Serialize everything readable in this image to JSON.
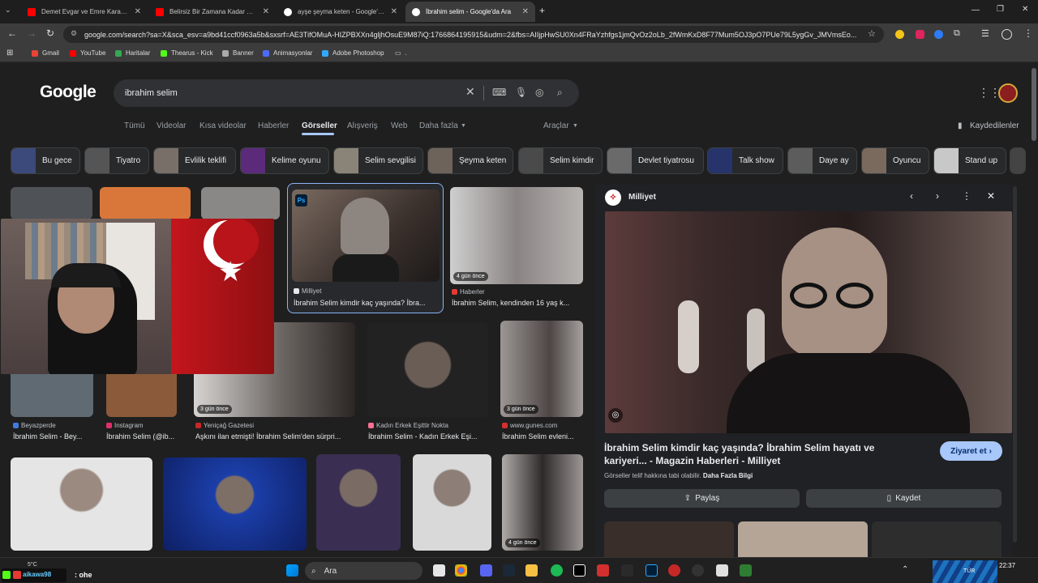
{
  "browser": {
    "tabs": [
      {
        "title": "Demet Evgar ve Emre Karayel'in",
        "favicon": "youtube-icon",
        "color": "#ff0000"
      },
      {
        "title": "Belirsiz Bir Zamana Kadar Güle",
        "favicon": "youtube-icon",
        "color": "#ff0000"
      },
      {
        "title": "ayşe şeyma keten - Google'da A",
        "favicon": "google-icon",
        "color": "#ffffff"
      },
      {
        "title": "İbrahim selim - Google'da Ara",
        "favicon": "google-icon",
        "color": "#ffffff"
      }
    ],
    "new_tab": "+",
    "url": "google.com/search?sa=X&sca_esv=a9bd41ccf0963a5b&sxsrf=AE3TifOMuA-HIZPBXXn4gljhOsuE9M87iQ:1766864195915&udm=2&fbs=AIIjpHwSU0Xn4FRaYzhfgs1jmQvOz2oLb_2fWmKxD8F77Mum5OJ3pO7PUe79L5ygGv_JMVmsEo...",
    "bookmarks": [
      {
        "label": "Gmail",
        "color": "#ea4335"
      },
      {
        "label": "YouTube",
        "color": "#ff0000"
      },
      {
        "label": "Haritalar",
        "color": "#34a853"
      },
      {
        "label": "Thearus - Kick",
        "color": "#53fc18"
      },
      {
        "label": "Banner",
        "color": "#aaaaaa"
      },
      {
        "label": "Animasyonlar",
        "color": "#4d6bfe"
      },
      {
        "label": "Adobe Photoshop",
        "color": "#31a8ff"
      },
      {
        "label": ".",
        "color": "#e8e8e8"
      }
    ]
  },
  "google": {
    "logo": "Google",
    "query": "ibrahim selim",
    "nav": [
      "Tümü",
      "Videolar",
      "Kısa videolar",
      "Haberler",
      "Görseller",
      "Alışveriş",
      "Web",
      "Daha fazla"
    ],
    "selected_nav": "Görseller",
    "tools": "Araçlar",
    "saved": "Kaydedilenler",
    "chips": [
      "Bu gece",
      "Tiyatro",
      "Evlilik teklifi",
      "Kelime oyunu",
      "Selim sevgilisi",
      "Şeyma keten",
      "Selim kimdir",
      "Devlet tiyatrosu",
      "Talk show",
      "Daye ay",
      "Oyuncu",
      "Stand up"
    ]
  },
  "results": {
    "row1": [
      {
        "source": "Milliyet",
        "title": "İbrahim Selim kimdir kaç yaşında? İbra...",
        "src_color": "#e8e8e8",
        "img_color": "#6a5a52"
      },
      {
        "source": "Haberler",
        "title": "İbrahim Selim, kendinden 16 yaş k...",
        "badge": "4 gün önce",
        "src_color": "#e53935",
        "img_color": "#7a7574"
      }
    ],
    "row2": [
      {
        "source": "Beyazperde",
        "title": "İbrahim Selim - Bey...",
        "src_color": "#3f7be0",
        "img_color": "#5f6a72"
      },
      {
        "source": "Instagram",
        "title": "İbrahim Selim (@ib...",
        "src_color": "#e1306c",
        "img_color": "#8a5a3a"
      },
      {
        "source": "Yeniçağ Gazetesi",
        "title": "Aşkını ilan etmişti! İbrahim Selim'den sürpri...",
        "badge": "3 gün önce",
        "src_color": "#c62828",
        "img_color": "#8d8a88"
      },
      {
        "source": "Kadın Erkek Eşittir Nokta",
        "title": "İbrahim Selim - Kadın Erkek Eşi...",
        "src_color": "#ff6f91",
        "img_color": "#2a2a2a"
      },
      {
        "source": "www.gunes.com",
        "title": "İbrahim Selim evleni...",
        "badge": "3 gün önce",
        "src_color": "#d32f2f",
        "img_color": "#7b7674"
      }
    ],
    "row3_badge": "4 gün önce",
    "ps_badge": "Ps"
  },
  "panel": {
    "source": "Milliyet",
    "title": "İbrahim Selim kimdir kaç yaşında? İbrahim Selim hayatı ve kariyeri... - Magazin Haberleri - Milliyet",
    "visit": "Ziyaret et",
    "copyright": "Görseller telif hakkına tabi olabilir.",
    "more_info": "Daha Fazla Bilgi",
    "share": "Paylaş",
    "save": "Kaydet"
  },
  "overlay": {
    "channel": "aikawa98",
    "suffix": ": ohe"
  },
  "taskbar": {
    "weather": "5°C",
    "search": "Ara",
    "time": "22:37",
    "lang": "TÜR"
  }
}
